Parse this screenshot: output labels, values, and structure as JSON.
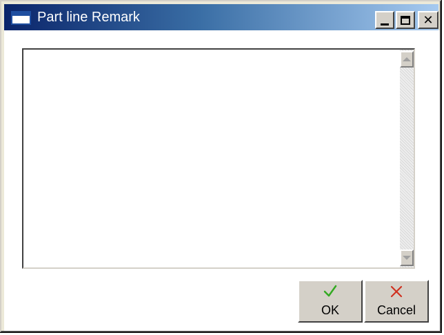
{
  "window": {
    "title": "Part line Remark"
  },
  "titlebar_buttons": {
    "minimize": "minimize",
    "maximize": "maximize",
    "close": "✕"
  },
  "remark": {
    "value": ""
  },
  "buttons": {
    "ok_label": "OK",
    "cancel_label": "Cancel"
  },
  "colors": {
    "ok_check": "#33aa22",
    "cancel_x": "#d03020",
    "titlebar_start": "#0a246a",
    "titlebar_end": "#a6caf0"
  },
  "icons": {
    "window": "window-icon",
    "ok": "checkmark-icon",
    "cancel": "x-mark-icon",
    "scroll_up": "scroll-up-arrow-icon",
    "scroll_down": "scroll-down-arrow-icon"
  }
}
